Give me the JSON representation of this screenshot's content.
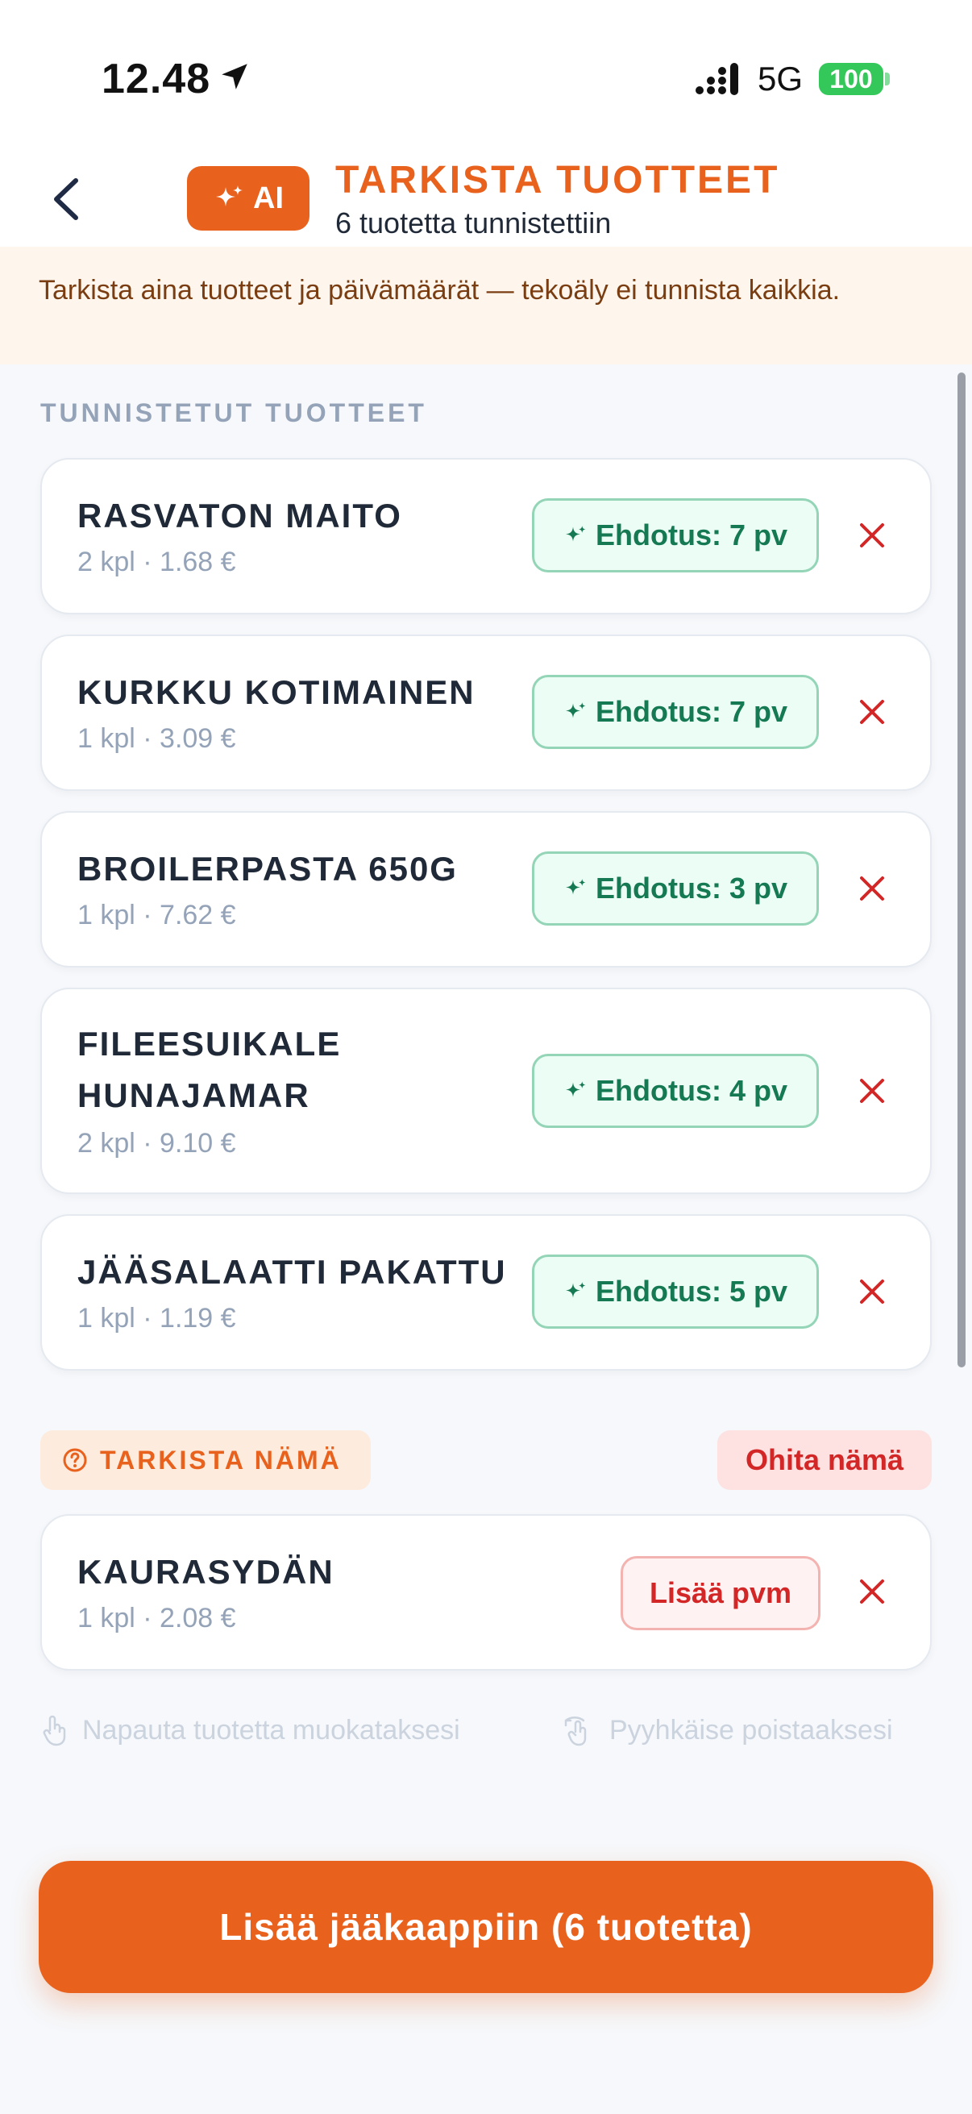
{
  "status_bar": {
    "time": "12.48",
    "network": "5G",
    "battery": "100"
  },
  "header": {
    "ai_badge": "AI",
    "title": "TARKISTA TUOTTEET",
    "subtitle": "6 tuotetta tunnistettiin"
  },
  "warning": {
    "text": "Tarkista aina tuotteet ja päivämäärät — tekoäly ei tunnista kaikkia."
  },
  "identified": {
    "section_label": "TUNNISTETUT TUOTTEET",
    "items": [
      {
        "name": "RASVATON MAITO",
        "meta": "2 kpl · 1.68 €",
        "suggestion": "Ehdotus: 7 pv"
      },
      {
        "name": "KURKKU KOTIMAINEN",
        "meta": "1 kpl · 3.09 €",
        "suggestion": "Ehdotus: 7 pv"
      },
      {
        "name": "BROILERPASTA 650G",
        "meta": "1 kpl · 7.62 €",
        "suggestion": "Ehdotus: 3 pv"
      },
      {
        "name": "FILEESUIKALE HUNAJAMAR",
        "meta": "2 kpl · 9.10 €",
        "suggestion": "Ehdotus: 4 pv"
      },
      {
        "name": "JÄÄSALAATTI PAKATTU",
        "meta": "1 kpl · 1.19 €",
        "suggestion": "Ehdotus: 5 pv"
      }
    ]
  },
  "review": {
    "chip_label": "TARKISTA NÄMÄ",
    "skip_label": "Ohita nämä",
    "items": [
      {
        "name": "KAURASYDÄN",
        "meta": "1 kpl · 2.08 €",
        "action": "Lisää pvm"
      }
    ]
  },
  "hints": {
    "tap": "Napauta tuotetta muokataksesi",
    "swipe": "Pyyhkäise poistaaksesi"
  },
  "primary_action": {
    "label": "Lisää jääkaappiin (6 tuotetta)"
  },
  "colors": {
    "accent": "#e8621e",
    "suggestion_green": "#157a53",
    "danger_red": "#d32626"
  }
}
